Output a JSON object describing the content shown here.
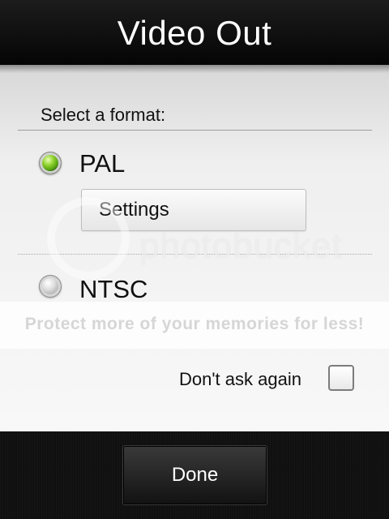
{
  "header": {
    "title": "Video Out"
  },
  "format_section": {
    "label": "Select a format:",
    "options": [
      {
        "label": "PAL",
        "selected": true
      },
      {
        "label": "NTSC",
        "selected": false
      }
    ],
    "settings_button": "Settings"
  },
  "watermark": {
    "logo_text": "photobucket",
    "caption": "Protect more of your memories for less!"
  },
  "dont_ask": {
    "label": "Don't ask again",
    "checked": false
  },
  "footer": {
    "done_label": "Done"
  },
  "colors": {
    "header_bg": "#0a0a0a",
    "panel_bg": "#f2f2f2",
    "radio_selected": "#7cc21f",
    "footer_bg": "#101010"
  }
}
